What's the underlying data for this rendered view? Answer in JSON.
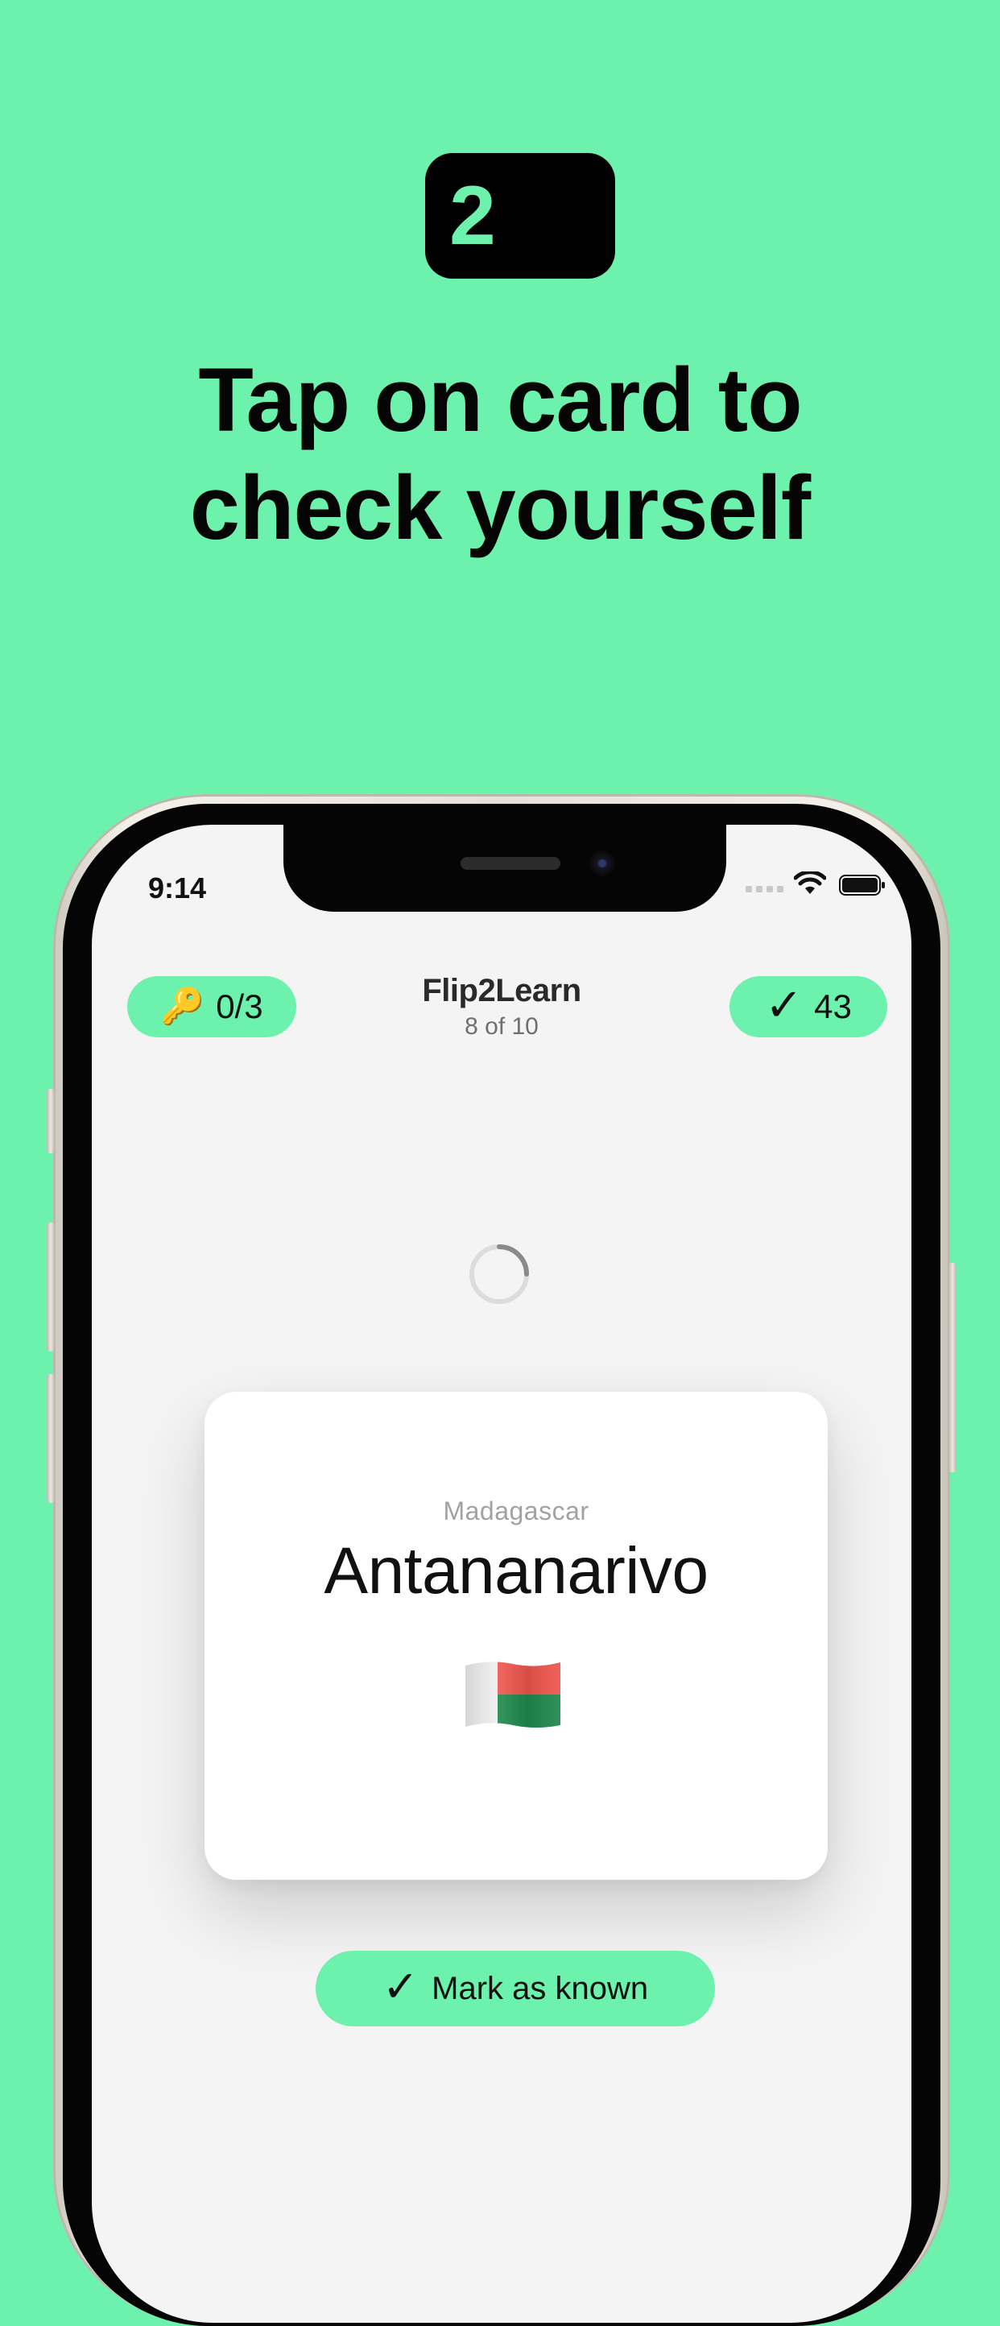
{
  "promo": {
    "step_number": "2",
    "headline_line1": "Tap on card to",
    "headline_line2": "check yourself"
  },
  "status_bar": {
    "time": "9:14"
  },
  "app_header": {
    "keys_count": "0/3",
    "key_icon": "🔑",
    "title": "Flip2Learn",
    "progress": "8 of 10",
    "known_count": "43",
    "check_icon": "✓"
  },
  "card": {
    "country": "Madagascar",
    "capital": "Antananarivo",
    "flag_icon": "madagascar-flag"
  },
  "mark_button": {
    "check_icon": "✓",
    "label": "Mark as known"
  },
  "colors": {
    "background": "#6cf2ad",
    "accent": "#6cf2ad",
    "badge": "#000000",
    "screen": "#f4f4f4",
    "card": "#ffffff"
  }
}
